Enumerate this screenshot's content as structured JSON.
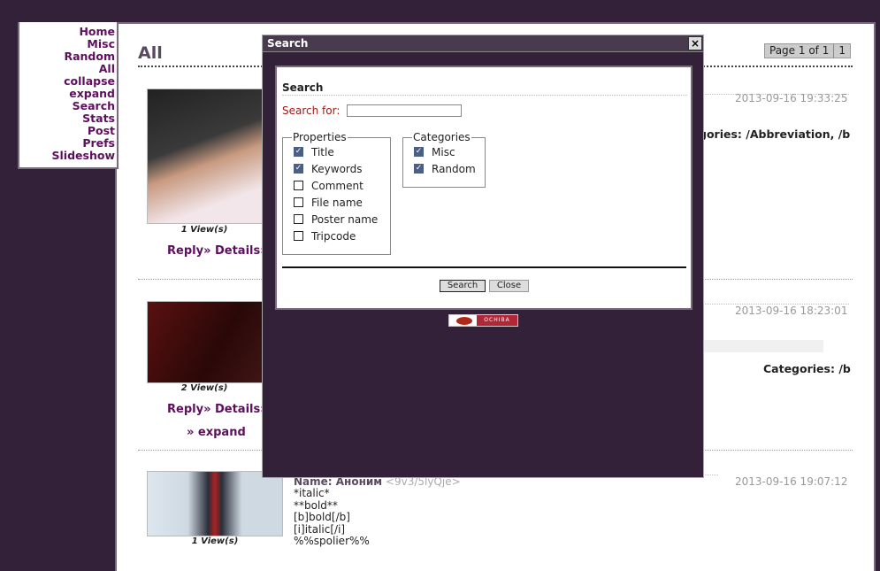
{
  "sidebar": {
    "items": [
      "Home",
      "Misc",
      "Random",
      "All",
      "collapse",
      "expand",
      "Search",
      "Stats",
      "Post",
      "Prefs",
      "Slideshow"
    ]
  },
  "main": {
    "title": "All",
    "pager": {
      "label": "Page 1 of 1",
      "page": "1"
    }
  },
  "posts": [
    {
      "views": "1 View(s)",
      "links": "Reply» Details»",
      "date": "2013-09-16 19:33:25",
      "categories": "gories: /Abbreviation, /b"
    },
    {
      "views": "2 View(s)",
      "links": "Reply» Details»",
      "expand": "» expand",
      "date": "2013-09-16 18:23:01",
      "categories": "Categories: /b"
    },
    {
      "views": "1 View(s)",
      "name": "Name: Аноним",
      "tripcode": "<9v3/5lyQje>",
      "date": "2013-09-16 19:07:12",
      "body": [
        "*italic*",
        "**bold**",
        "[b]bold[/b]",
        "[i]italic[/i]",
        "%%spolier%%"
      ]
    }
  ],
  "dialog": {
    "title": "Search",
    "close_icon": "×",
    "heading": "Search",
    "search_for_label": "Search for:",
    "search_value": "",
    "properties": {
      "legend": "Properties",
      "items": [
        {
          "label": "Title",
          "checked": true
        },
        {
          "label": "Keywords",
          "checked": true
        },
        {
          "label": "Comment",
          "checked": false
        },
        {
          "label": "File name",
          "checked": false
        },
        {
          "label": "Poster name",
          "checked": false
        },
        {
          "label": "Tripcode",
          "checked": false
        }
      ]
    },
    "categories": {
      "legend": "Categories",
      "items": [
        {
          "label": "Misc",
          "checked": true
        },
        {
          "label": "Random",
          "checked": true
        }
      ]
    },
    "search_button": "Search",
    "close_button": "Close",
    "logo_text": "OCHIBA"
  }
}
